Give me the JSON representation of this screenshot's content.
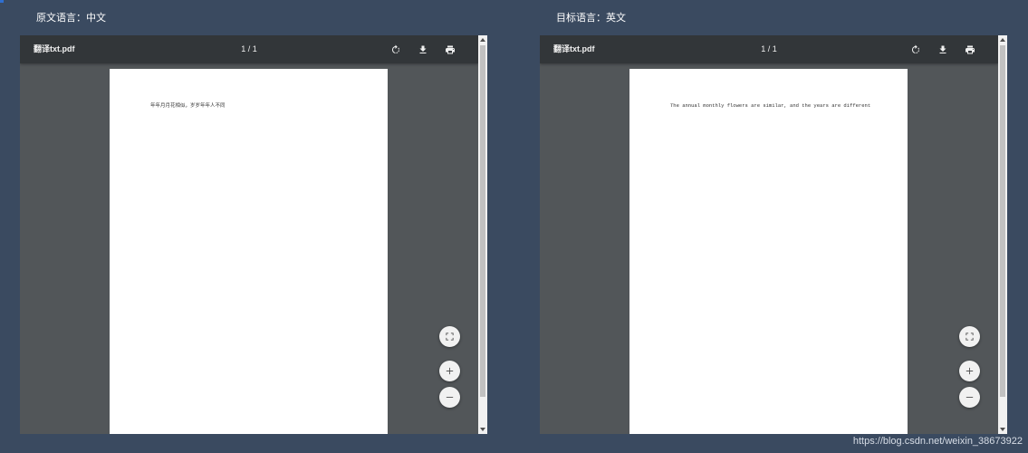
{
  "colors": {
    "background": "#3a4a60",
    "viewer_bg": "#525659",
    "toolbar_bg": "#323639",
    "page_bg": "#ffffff",
    "accent_corner": "#2f6fd0"
  },
  "left_pane": {
    "title": "原文语言：中文",
    "viewer": {
      "file_name": "翻译txt.pdf",
      "page_counter": "1 / 1",
      "page_text": "年年月月花相似，岁岁年年人不同",
      "toolbar_icons": [
        "rotate-icon",
        "download-icon",
        "print-icon"
      ],
      "float_icons": [
        "fit-to-page-icon",
        "zoom-in-icon",
        "zoom-out-icon"
      ]
    }
  },
  "right_pane": {
    "title": "目标语言：英文",
    "viewer": {
      "file_name": "翻译txt.pdf",
      "page_counter": "1 / 1",
      "page_text": "The annual monthly flowers are similar, and the years are different",
      "toolbar_icons": [
        "rotate-icon",
        "download-icon",
        "print-icon"
      ],
      "float_icons": [
        "fit-to-page-icon",
        "zoom-in-icon",
        "zoom-out-icon"
      ]
    }
  },
  "watermark": "https://blog.csdn.net/weixin_38673922"
}
